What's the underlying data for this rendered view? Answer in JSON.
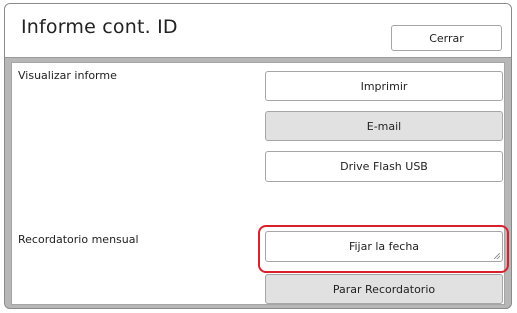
{
  "dialog": {
    "title": "Informe cont. ID",
    "close_label": "Cerrar"
  },
  "view_report": {
    "label": "Visualizar informe",
    "buttons": {
      "print": "Imprimir",
      "email": "E-mail",
      "usb": "Drive Flash USB"
    }
  },
  "monthly_reminder": {
    "label": "Recordatorio mensual",
    "buttons": {
      "set_date": "Fijar la fecha",
      "stop": "Parar Recordatorio"
    }
  },
  "colors": {
    "highlight": "#d9212e",
    "shaded_button": "#e1e1e1",
    "background": "#b7b7b7"
  }
}
